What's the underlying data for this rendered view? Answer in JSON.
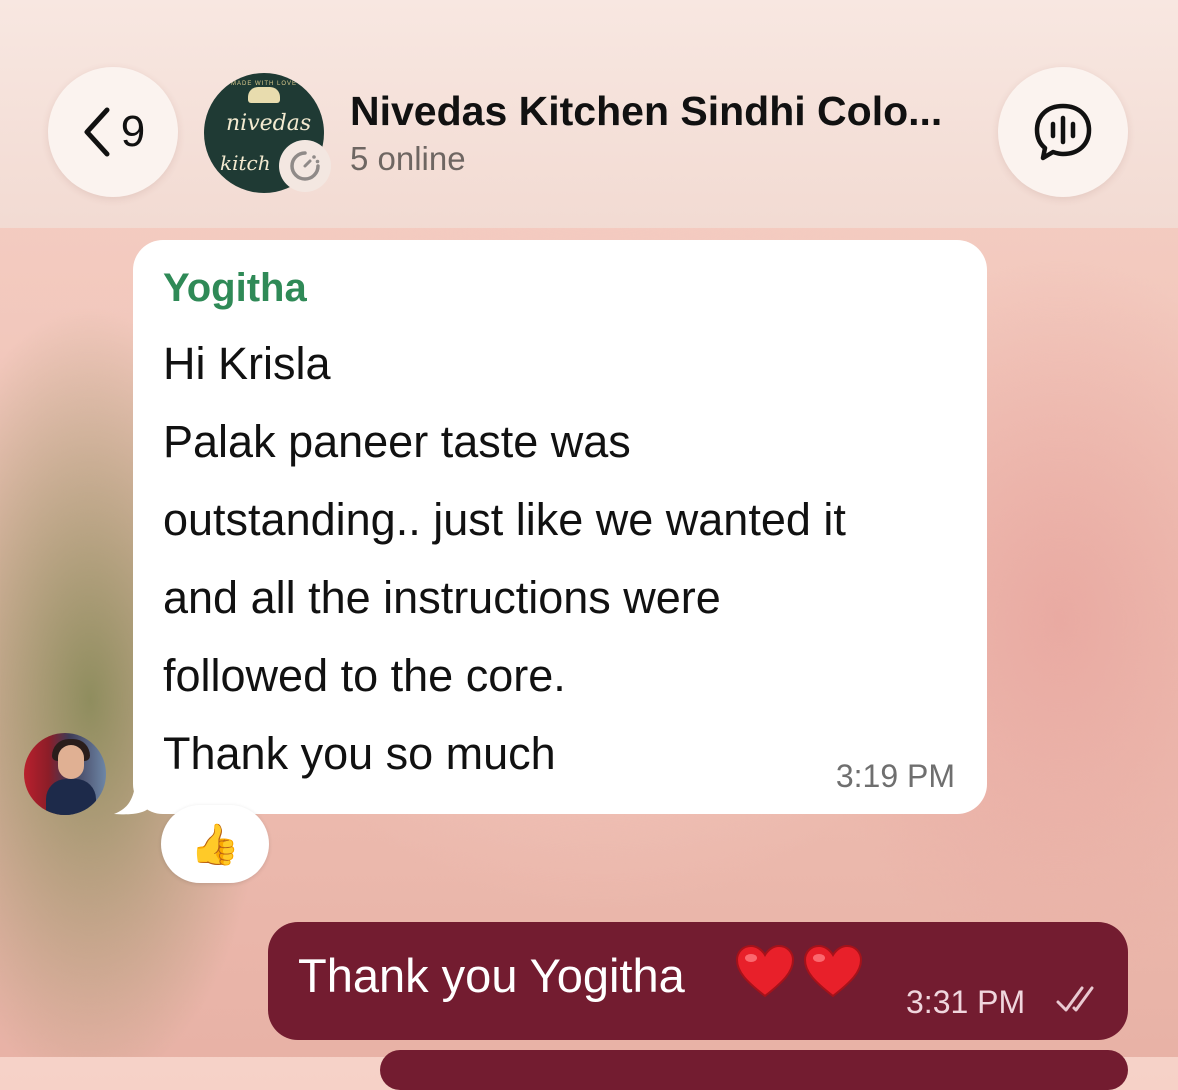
{
  "header": {
    "back_count": "9",
    "group_title": "Nivedas Kitchen Sindhi Colo...",
    "status": "5 online",
    "avatar": {
      "top_text": "MADE WITH LOVE",
      "name_line1": "nivedas",
      "name_line2": "kitch"
    },
    "icons": {
      "back": "chevron-left-icon",
      "loading": "loading-icon",
      "voice_chat": "voice-chat-icon"
    }
  },
  "messages": {
    "incoming": {
      "sender": "Yogitha",
      "lines": [
        "Hi Krisla",
        "Palak paneer taste was",
        "outstanding.. just like we wanted it",
        "and all the instructions were",
        "followed to the core.",
        "Thank you so much"
      ],
      "time": "3:19 PM",
      "reaction": "👍"
    },
    "outgoing": {
      "text": "Thank you Yogitha",
      "emoji": [
        "❤️",
        "❤️"
      ],
      "time": "3:31 PM",
      "status_icon": "double-check-icon"
    }
  },
  "colors": {
    "sender_name": "#2f8a57",
    "outgoing_bubble": "#731c30",
    "incoming_bubble": "#ffffff"
  }
}
